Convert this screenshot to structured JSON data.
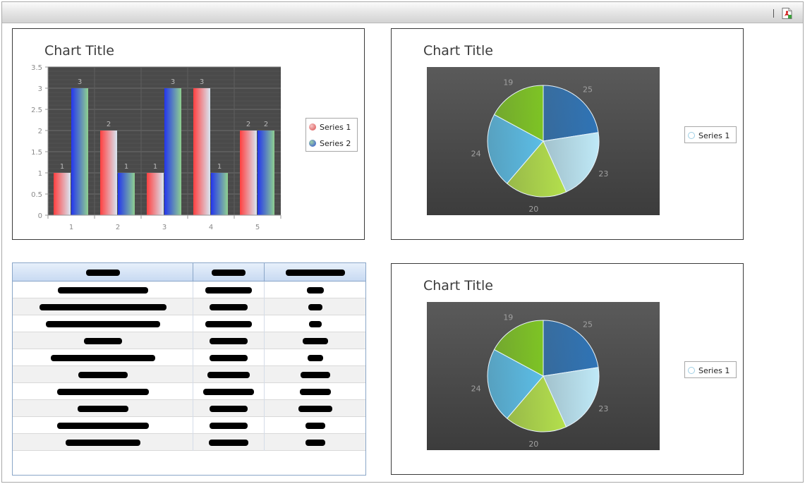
{
  "toolbar": {
    "export_icon": "pdf-export-icon"
  },
  "charts": [
    {
      "type": "bar",
      "title": "Chart Title",
      "categories": [
        "1",
        "2",
        "3",
        "4",
        "5"
      ],
      "series": [
        {
          "name": "Series 1",
          "values": [
            1,
            2,
            1,
            3,
            2
          ],
          "color": "#e84a4a"
        },
        {
          "name": "Series 2",
          "values": [
            3,
            1,
            3,
            1,
            2
          ],
          "color": "#3a57e6"
        }
      ],
      "ylim": [
        0,
        3.5
      ],
      "yticks": [
        "0",
        "0.5",
        "1",
        "1.5",
        "2",
        "2.5",
        "3",
        "3.5"
      ],
      "plot_background": "#4a4a4a",
      "legend": "right"
    },
    {
      "type": "pie",
      "title": "Chart Title",
      "series": [
        {
          "name": "Series 1"
        }
      ],
      "slices": [
        {
          "value": 25,
          "label": "25",
          "color": "#2f74b6"
        },
        {
          "value": 23,
          "label": "23",
          "color": "#bfe9f7"
        },
        {
          "value": 20,
          "label": "20",
          "color": "#b4e04c"
        },
        {
          "value": 24,
          "label": "24",
          "color": "#5bbde6"
        },
        {
          "value": 19,
          "label": "19",
          "color": "#7ec424"
        }
      ],
      "plot_background": "#4a4a4a",
      "legend": "right"
    },
    {
      "type": "pie",
      "title": "Chart Title",
      "series": [
        {
          "name": "Series 1"
        }
      ],
      "slices": [
        {
          "value": 25,
          "label": "25",
          "color": "#2f74b6"
        },
        {
          "value": 23,
          "label": "23",
          "color": "#bfe9f7"
        },
        {
          "value": 20,
          "label": "20",
          "color": "#b4e04c"
        },
        {
          "value": 24,
          "label": "24",
          "color": "#5bbde6"
        },
        {
          "value": 19,
          "label": "19",
          "color": "#7ec424"
        }
      ],
      "plot_background": "#4a4a4a",
      "legend": "right"
    }
  ],
  "grid": {
    "note": "redacted",
    "header_color": "#c8daf2",
    "row_count": 10
  }
}
